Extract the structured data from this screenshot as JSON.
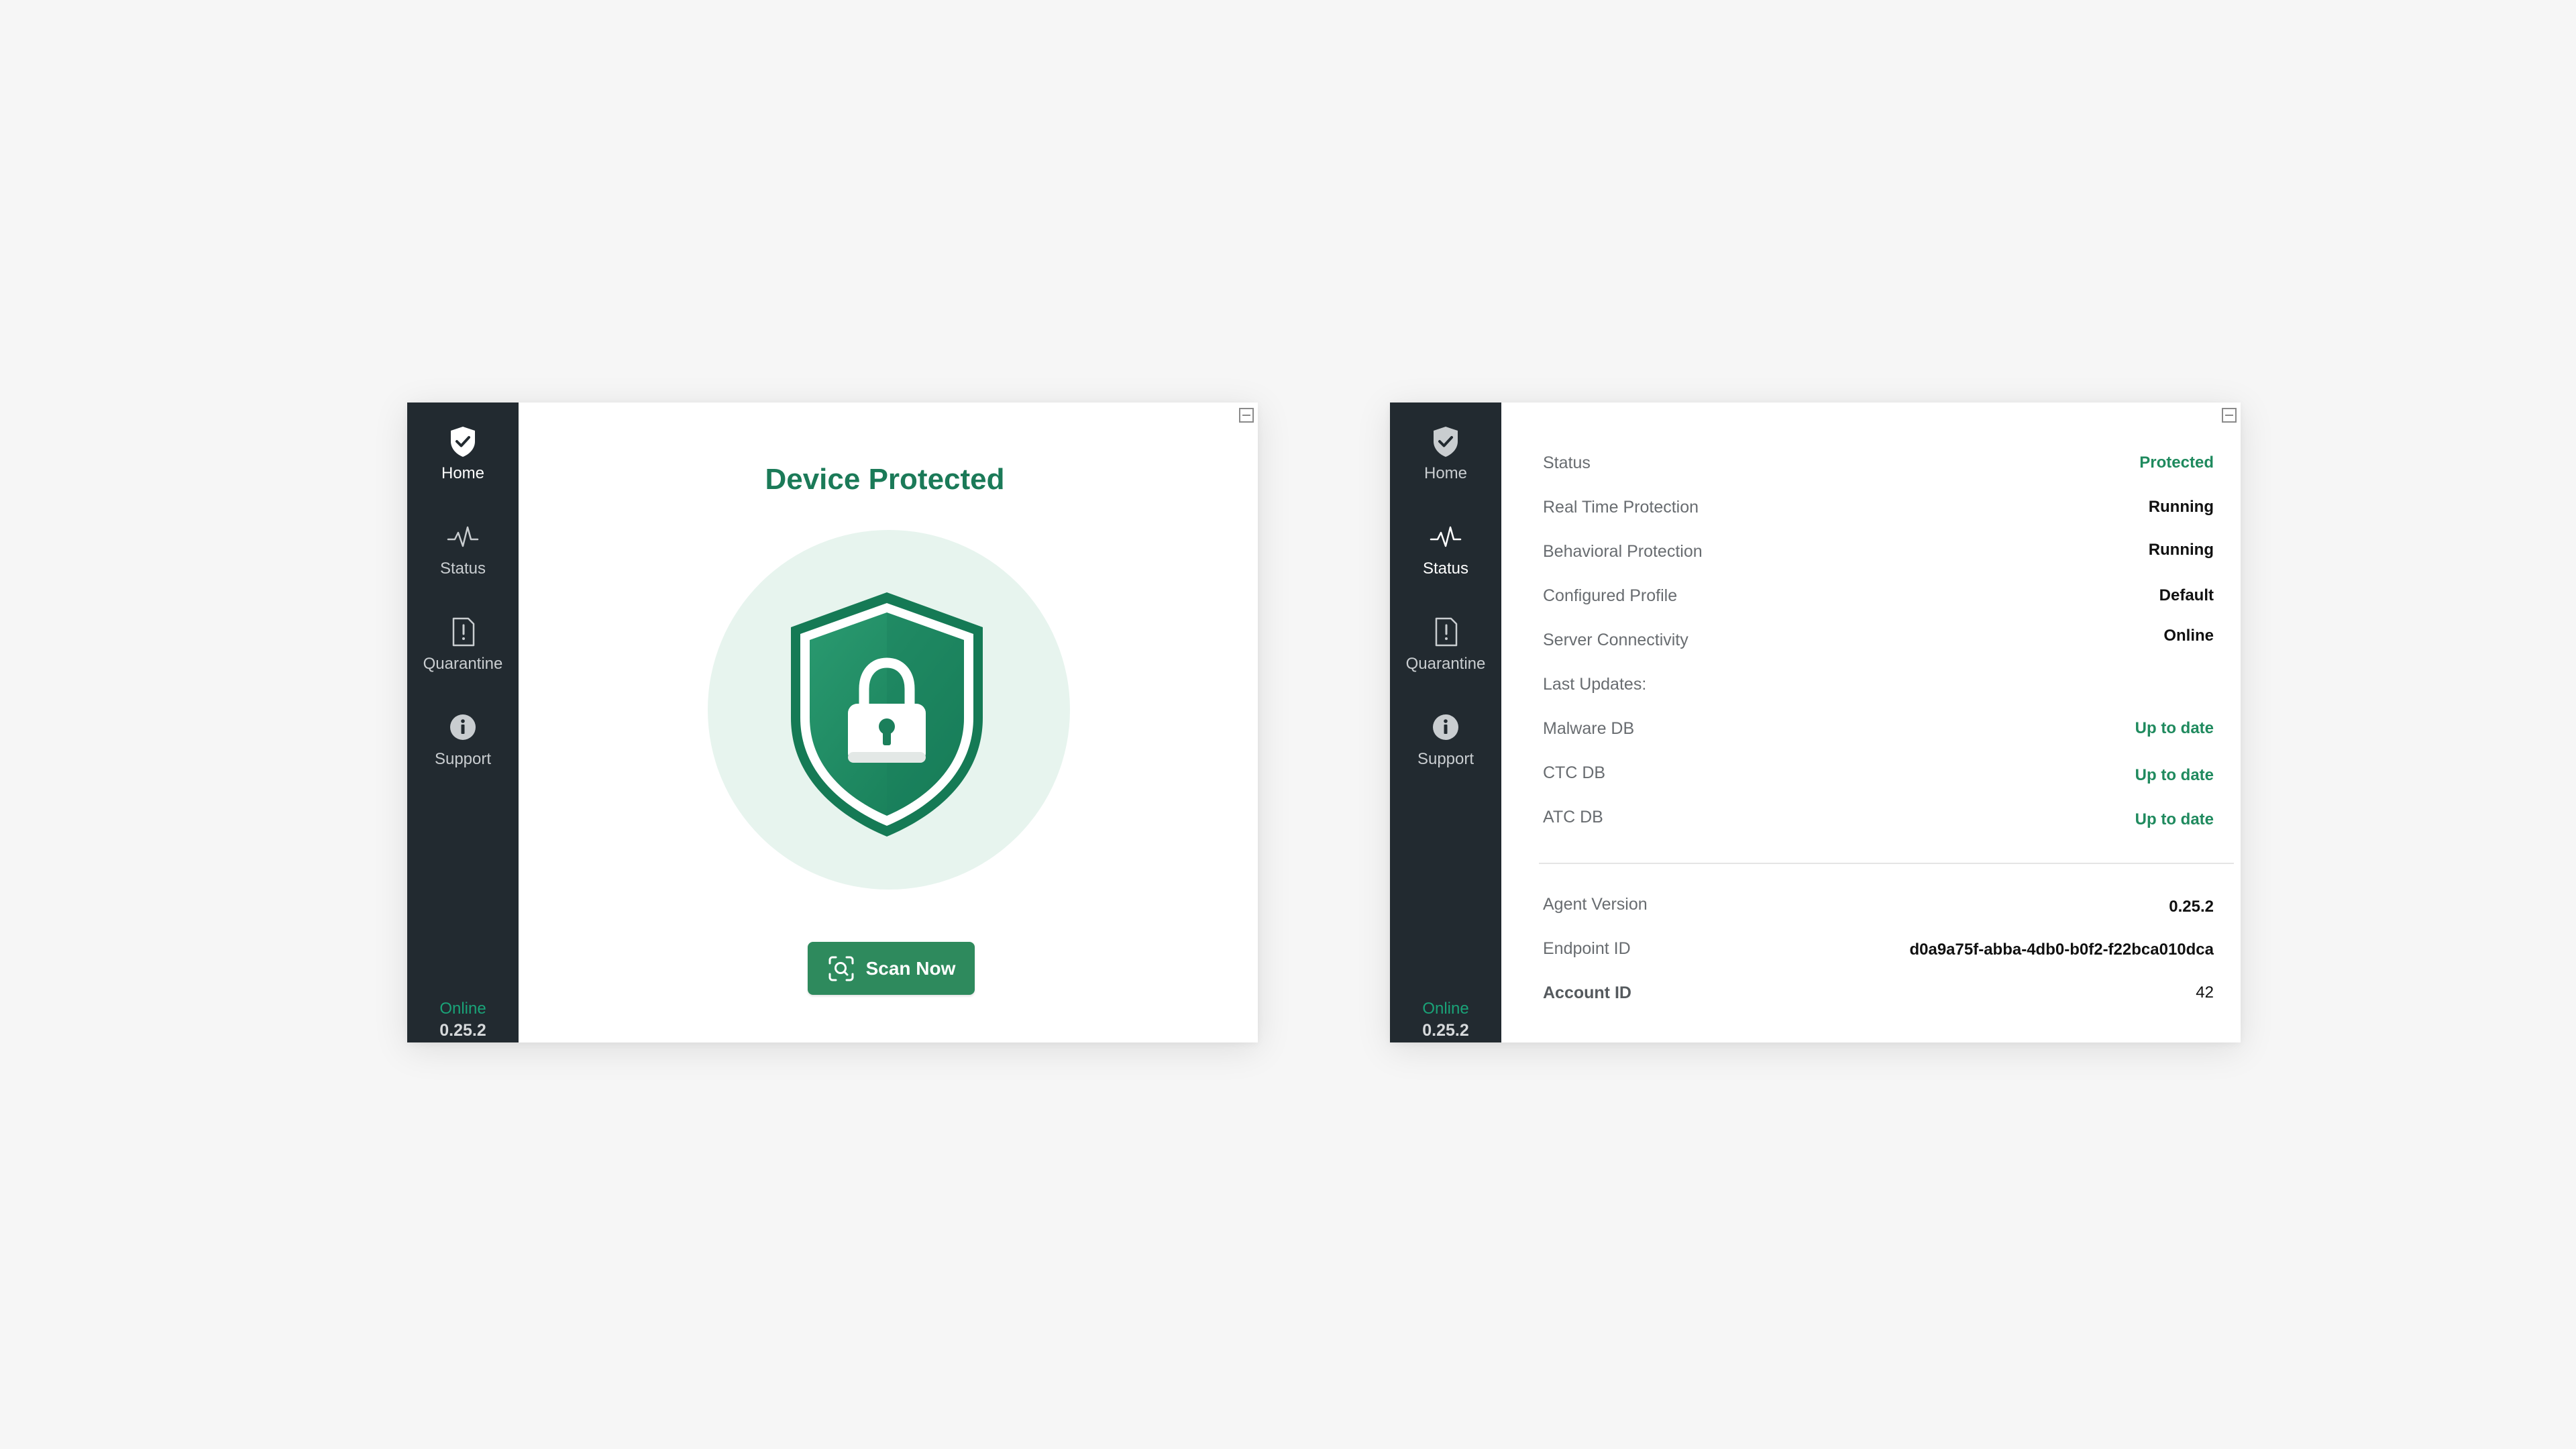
{
  "sidebar": {
    "items": [
      {
        "label": "Home",
        "icon": "shield-check-icon"
      },
      {
        "label": "Status",
        "icon": "pulse-icon"
      },
      {
        "label": "Quarantine",
        "icon": "file-alert-icon"
      },
      {
        "label": "Support",
        "icon": "info-icon"
      }
    ],
    "connection": "Online",
    "version": "0.25.2"
  },
  "home": {
    "title": "Device Protected",
    "scan_button": "Scan Now",
    "hero_icon": "shield-lock-icon"
  },
  "status_panel": {
    "rows": [
      {
        "label": "Status",
        "value": "Protected"
      },
      {
        "label": "Real Time Protection",
        "value": "Running"
      },
      {
        "label": "Behavioral Protection",
        "value": "Running"
      },
      {
        "label": "Configured Profile",
        "value": "Default"
      },
      {
        "label": "Server Connectivity",
        "value": "Online"
      },
      {
        "label": "Last Updates:",
        "value": ""
      },
      {
        "label": "Malware DB",
        "value": "Up to date"
      },
      {
        "label": "CTC DB",
        "value": "Up to date"
      },
      {
        "label": "ATC DB",
        "value": "Up to date"
      }
    ],
    "info": [
      {
        "label": "Agent Version",
        "value": "0.25.2"
      },
      {
        "label": "Endpoint ID",
        "value": "d0a9a75f-abba-4db0-b0f2-f22bca010dca"
      },
      {
        "label": "Account ID",
        "value": "42"
      }
    ]
  },
  "colors": {
    "accent": "#1b7a58",
    "sidebar": "#222a30",
    "online": "#1aa378",
    "button": "#2e8a5d",
    "background": "#f6f6f6"
  }
}
